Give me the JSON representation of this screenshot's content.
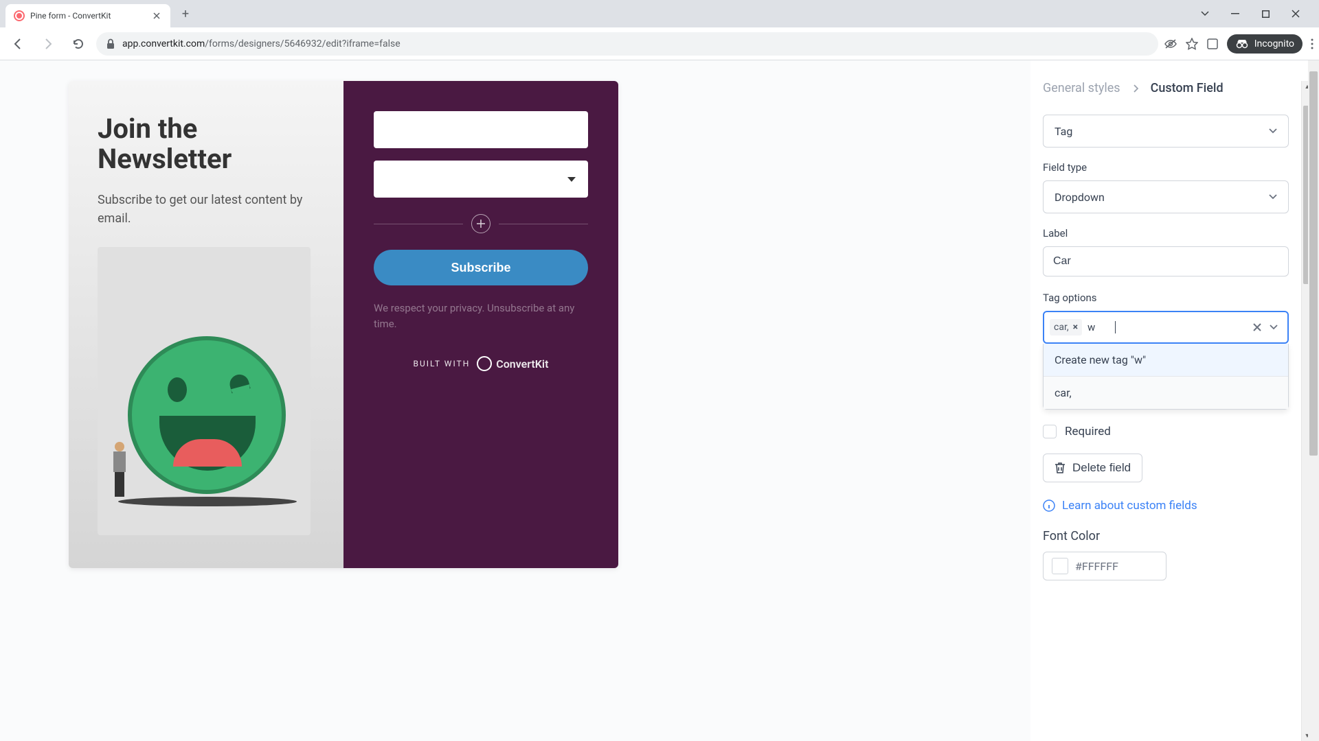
{
  "browser": {
    "tab_title": "Pine form - ConvertKit",
    "url_domain": "app.convertkit.com",
    "url_path": "/forms/designers/5646932/edit?iframe=false",
    "incognito_label": "Incognito"
  },
  "form": {
    "title": "Join the Newsletter",
    "subtitle": "Subscribe to get our latest content by email.",
    "subscribe_label": "Subscribe",
    "privacy": "We respect your privacy. Unsubscribe at any time.",
    "built_with": "BUILT WITH",
    "brand": "ConvertKit"
  },
  "panel": {
    "breadcrumb_back": "General styles",
    "breadcrumb_current": "Custom Field",
    "tag_select": "Tag",
    "field_type_label": "Field type",
    "field_type_value": "Dropdown",
    "label_label": "Label",
    "label_value": "Car",
    "tag_options_label": "Tag options",
    "existing_tag": "car,",
    "typing_value": "w",
    "create_option": "Create new tag \"w\"",
    "existing_option": "car,",
    "required_label": "Required",
    "delete_label": "Delete field",
    "learn_label": "Learn about custom fields",
    "font_color_label": "Font Color",
    "font_color_value": "#FFFFFF"
  }
}
